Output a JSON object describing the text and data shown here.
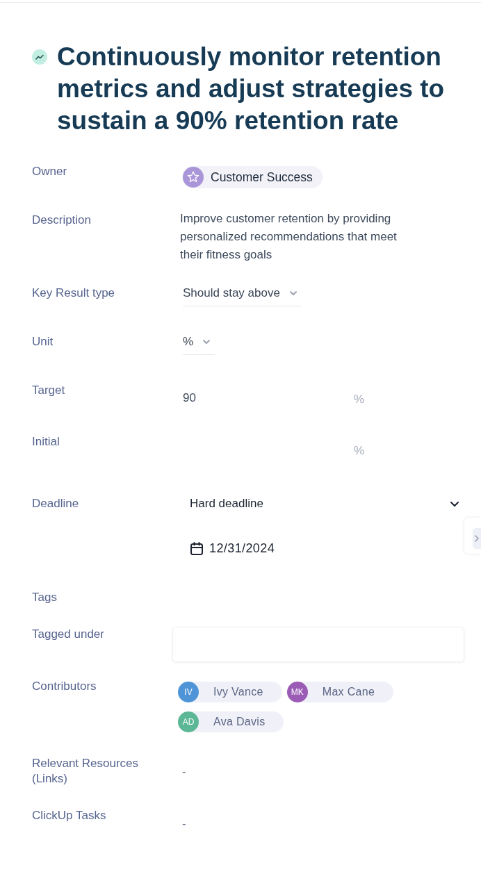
{
  "goal": {
    "title": "Continuously monitor retention metrics and adjust strategies to sustain a 90% retention rate"
  },
  "fields": [
    {
      "kind": "owner",
      "label": "Owner",
      "value": "Customer Success"
    },
    {
      "kind": "text",
      "label": "Description",
      "value": "Improve customer retention by providing personalized recommendations that meet their fitness goals"
    },
    {
      "kind": "select",
      "label": "Key Result type",
      "value": "Should stay above"
    },
    {
      "kind": "select",
      "label": "Unit",
      "value": "%"
    },
    {
      "kind": "number",
      "label": "Target",
      "value": "90",
      "unit": "%"
    },
    {
      "kind": "number",
      "label": "Initial",
      "unit": "%"
    },
    {
      "kind": "deadline",
      "label": "Deadline",
      "value": "Hard deadline",
      "date": "12/31/2024"
    },
    {
      "kind": "heading",
      "label": "Tags"
    },
    {
      "kind": "tags",
      "label": "Tagged under"
    },
    {
      "kind": "people",
      "label": "Contributors",
      "people": [
        {
          "initials": "IV",
          "name": "Ivy Vance",
          "color": "#4f94d6"
        },
        {
          "initials": "MK",
          "name": "Max Cane",
          "color": "#9a5cb5"
        },
        {
          "initials": "AD",
          "name": "Ava Davis",
          "color": "#5bb795"
        }
      ]
    },
    {
      "kind": "empty",
      "label": "Relevant Resources (Links)",
      "value": "-"
    },
    {
      "kind": "empty",
      "label": "ClickUp Tasks",
      "value": "-"
    }
  ]
}
